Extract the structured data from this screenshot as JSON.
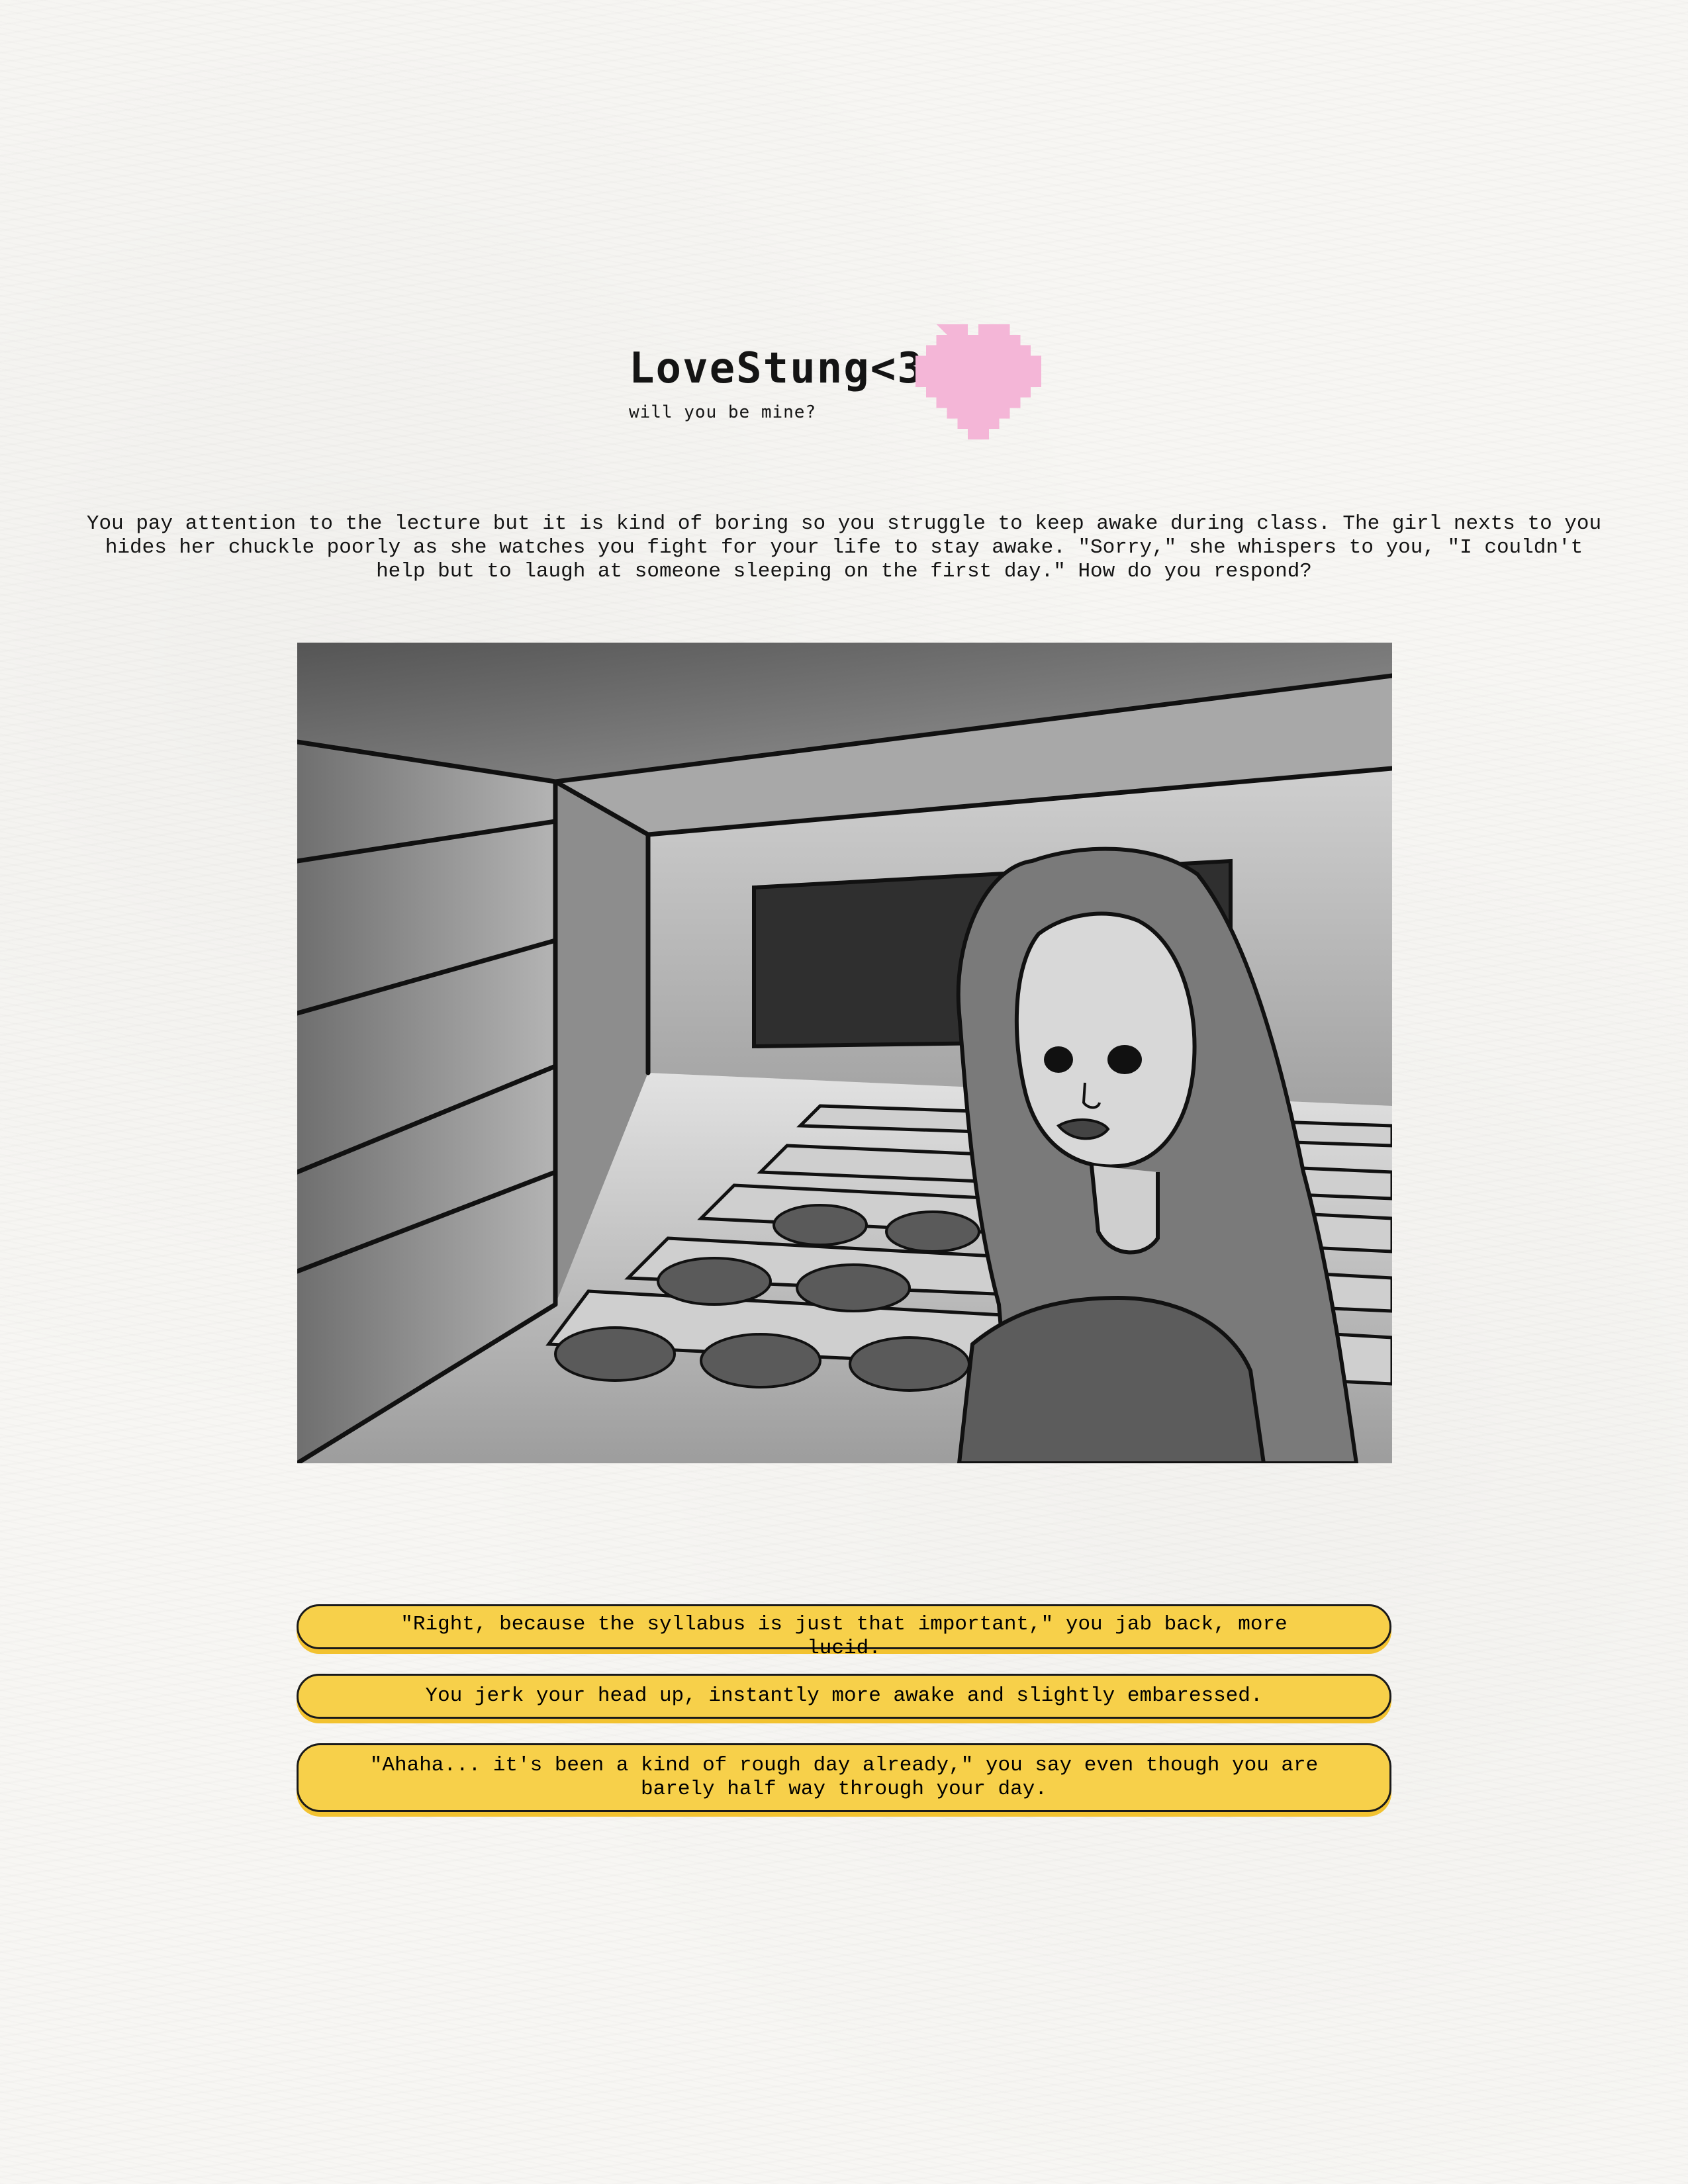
{
  "header": {
    "title": "LoveStung<3",
    "subtitle": "will you be mine?",
    "heart_icon": "pixel-heart-icon",
    "heart_color": "#f4b6d7"
  },
  "narrative": {
    "text": "You pay attention to the lecture but it is kind of boring so you struggle to keep awake during class. The girl nexts to you hides her chuckle poorly as she watches you fight for your life to stay awake. \"Sorry,\" she whispers to you, \"I couldn't help but to laugh at someone sleeping on the first day.\" How do you respond?"
  },
  "scene": {
    "icon": "lecture-hall-illustration"
  },
  "choices": [
    {
      "label": "\"Right, because the syllabus is just that important,\" you jab back, more lucid."
    },
    {
      "label": "You jerk your head up, instantly more awake and slightly embaressed."
    },
    {
      "label": "\"Ahaha... it's been a kind of rough day already,\" you say even though you are barely half way through your day."
    }
  ],
  "colors": {
    "choice_background": "#f7d04a",
    "choice_border": "#1a1a1a",
    "page_background": "#f7f6f3",
    "heart": "#f4b6d7"
  }
}
